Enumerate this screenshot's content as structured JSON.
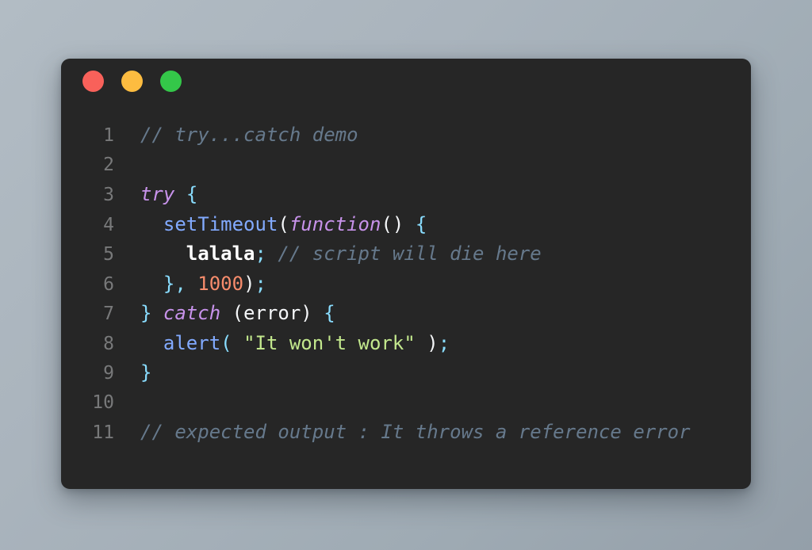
{
  "window": {
    "controls": [
      {
        "name": "close",
        "color": "#f8615a"
      },
      {
        "name": "minimize",
        "color": "#fdbc40"
      },
      {
        "name": "maximize",
        "color": "#34c749"
      }
    ]
  },
  "theme": {
    "backdrop_top_left": "#b2bcc4",
    "backdrop_bottom_right": "#949fa9",
    "card_background": "#262626",
    "line_number": "#78797a",
    "comment": "#66798c",
    "keyword": "#c792ea",
    "punctuation": "#89ddff",
    "function": "#82aaff",
    "plain": "#f5f7f9",
    "identifier": "#ffffff",
    "number": "#f78c6c",
    "string": "#c3e88d"
  },
  "editor": {
    "language": "javascript",
    "line_numbers": [
      "1",
      "2",
      "3",
      "4",
      "5",
      "6",
      "7",
      "8",
      "9",
      "10",
      "11"
    ],
    "lines": [
      {
        "number": "1",
        "text": "// try...catch demo",
        "tokens": [
          {
            "text": "// try...catch demo",
            "type": "comment"
          }
        ]
      },
      {
        "number": "2",
        "text": "",
        "tokens": []
      },
      {
        "number": "3",
        "text": "try {",
        "tokens": [
          {
            "text": "try",
            "type": "keyword"
          },
          {
            "text": " ",
            "type": "plain"
          },
          {
            "text": "{",
            "type": "punct"
          }
        ]
      },
      {
        "number": "4",
        "text": "  setTimeout(function() {",
        "tokens": [
          {
            "text": "  ",
            "type": "plain"
          },
          {
            "text": "setTimeout",
            "type": "func"
          },
          {
            "text": "(",
            "type": "plain"
          },
          {
            "text": "function",
            "type": "keyword"
          },
          {
            "text": "()",
            "type": "plain"
          },
          {
            "text": " ",
            "type": "plain"
          },
          {
            "text": "{",
            "type": "punct"
          }
        ]
      },
      {
        "number": "5",
        "text": "    lalala; // script will die here",
        "tokens": [
          {
            "text": "    ",
            "type": "plain"
          },
          {
            "text": "lalala",
            "type": "ident"
          },
          {
            "text": ";",
            "type": "punct"
          },
          {
            "text": " ",
            "type": "plain"
          },
          {
            "text": "// script will die here",
            "type": "comment"
          }
        ]
      },
      {
        "number": "6",
        "text": "  }, 1000);",
        "tokens": [
          {
            "text": "  ",
            "type": "plain"
          },
          {
            "text": "},",
            "type": "punct"
          },
          {
            "text": " ",
            "type": "plain"
          },
          {
            "text": "1000",
            "type": "number"
          },
          {
            "text": ")",
            "type": "plain"
          },
          {
            "text": ";",
            "type": "punct"
          }
        ]
      },
      {
        "number": "7",
        "text": "} catch (error) {",
        "tokens": [
          {
            "text": "}",
            "type": "punct"
          },
          {
            "text": " ",
            "type": "plain"
          },
          {
            "text": "catch",
            "type": "keyword"
          },
          {
            "text": " (error) ",
            "type": "plain"
          },
          {
            "text": "{",
            "type": "punct"
          }
        ]
      },
      {
        "number": "8",
        "text": "  alert( \"It won't work\" );",
        "tokens": [
          {
            "text": "  ",
            "type": "plain"
          },
          {
            "text": "alert",
            "type": "func"
          },
          {
            "text": "(",
            "type": "punct"
          },
          {
            "text": " ",
            "type": "plain"
          },
          {
            "text": "\"It won't work\"",
            "type": "string"
          },
          {
            "text": " ",
            "type": "plain"
          },
          {
            "text": ")",
            "type": "plain"
          },
          {
            "text": ";",
            "type": "punct"
          }
        ]
      },
      {
        "number": "9",
        "text": "}",
        "tokens": [
          {
            "text": "}",
            "type": "punct"
          }
        ]
      },
      {
        "number": "10",
        "text": "",
        "tokens": []
      },
      {
        "number": "11",
        "text": "// expected output : It throws a reference error",
        "tokens": [
          {
            "text": "// expected output : It throws a reference error",
            "type": "comment"
          }
        ]
      }
    ]
  }
}
